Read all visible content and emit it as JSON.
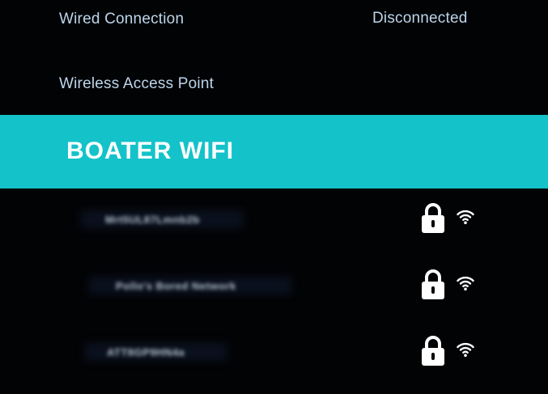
{
  "connections": {
    "wired_label": "Wired Connection",
    "wired_status": "Disconnected",
    "wap_label": "Wireless Access Point"
  },
  "selected_network": {
    "ssid": "BOATER WIFI",
    "highlight_color": "#13c3c9"
  },
  "networks": [
    {
      "name": "Mrt5UL87Lmnb2b",
      "secured": true,
      "icon_lock": "lock-icon",
      "icon_signal": "wifi-signal-icon"
    },
    {
      "name": "Pollo's Bored Network",
      "secured": true,
      "icon_lock": "lock-icon",
      "icon_signal": "wifi-signal-icon"
    },
    {
      "name": "ATT8GP9HN4a",
      "secured": true,
      "icon_lock": "lock-icon",
      "icon_signal": "wifi-signal-icon"
    }
  ],
  "colors": {
    "background": "#020305",
    "label_text": "#bcd5ea",
    "highlight": "#13c3c9"
  }
}
